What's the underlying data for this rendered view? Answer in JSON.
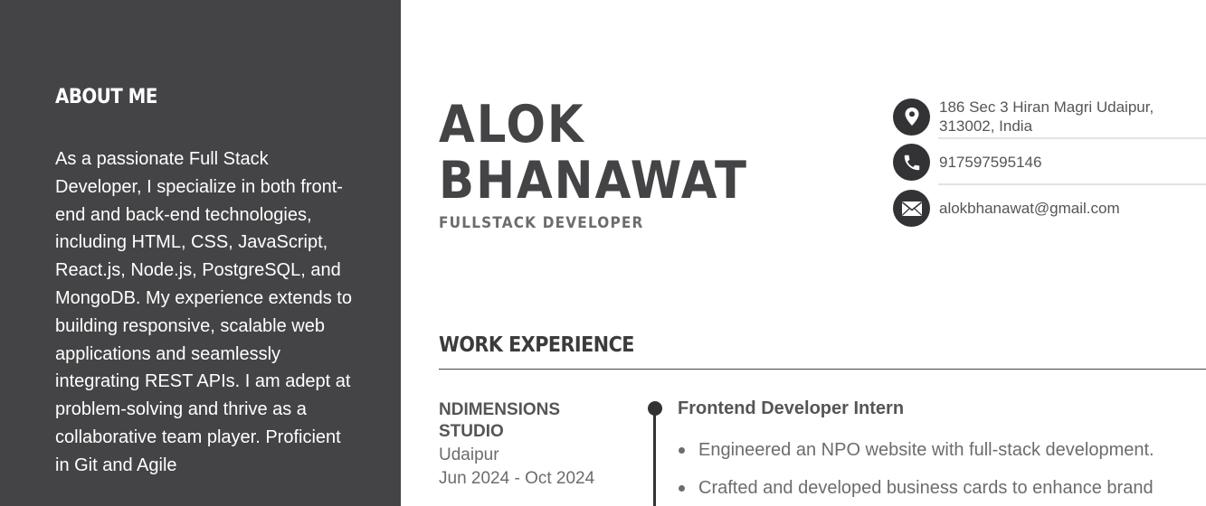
{
  "about": {
    "title": "About Me",
    "text": "As a passionate Full Stack Developer, I specialize in both front-end and back-end technologies, including HTML, CSS, JavaScript, React.js, Node.js, PostgreSQL, and MongoDB. My experience extends to building responsive, scalable web applications and seamlessly integrating REST APIs. I am adept at problem-solving and thrive as a collaborative team player. Proficient in Git and Agile"
  },
  "header": {
    "first_name": "Alok",
    "last_name": "Bhanawat",
    "role": "Fullstack Developer"
  },
  "contacts": {
    "address": "186 Sec 3 Hiran Magri Udaipur, 313002, India",
    "phone": "917597595146",
    "email": "alokbhanawat@gmail.com",
    "icons": [
      "location-pin-icon",
      "phone-icon",
      "envelope-icon"
    ]
  },
  "work": {
    "title": "Work Experience",
    "jobs": [
      {
        "company": "NDimensions Studio",
        "location": "Udaipur",
        "dates": "Jun 2024 - Oct 2024",
        "role": "Frontend Developer Intern",
        "bullets": [
          "Engineered an NPO website with full-stack development.",
          "Crafted and developed business cards to enhance brand"
        ]
      }
    ]
  },
  "colors": {
    "sidebar_bg": "#444446",
    "icon_bg": "#333336",
    "text_dark": "#444446",
    "text_muted": "#6c6c6e"
  }
}
